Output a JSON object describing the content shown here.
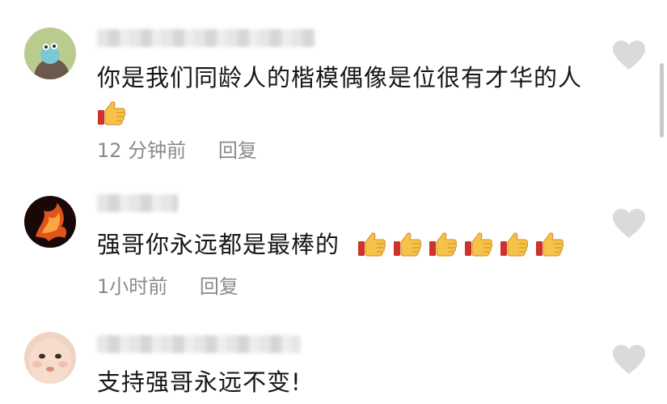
{
  "comments": [
    {
      "text": "你是我们同龄人的楷模偶像是位很有才华的人",
      "thumbs": 1,
      "time": "12 分钟前",
      "reply": "回复",
      "like_icon": "heart-outline-icon"
    },
    {
      "text": "强哥你永远都是最棒的",
      "thumbs": 6,
      "time": "1小时前",
      "reply": "回复",
      "like_icon": "heart-outline-icon"
    },
    {
      "text": "支持强哥永远不变!",
      "thumbs": 0,
      "like_icon": "heart-outline-icon"
    }
  ],
  "icons": {
    "thumbs_up": "thumbs-up-emoji-icon",
    "like": "heart-outline-icon"
  },
  "colors": {
    "text": "#161616",
    "meta": "#8a8a8a",
    "heart": "#dadada",
    "thumb": "#f6c24a"
  }
}
